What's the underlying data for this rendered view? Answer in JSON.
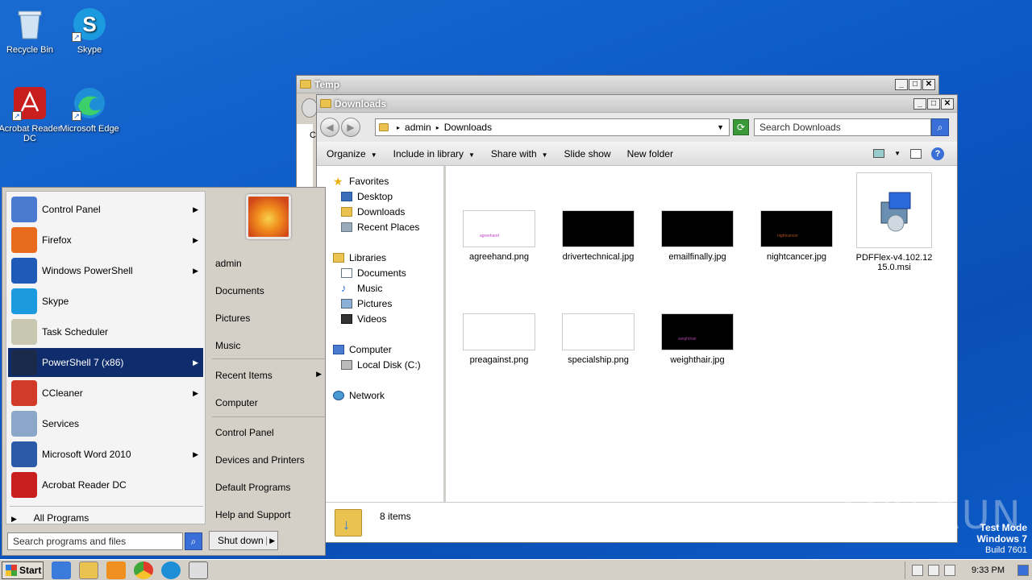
{
  "desktop": {
    "icons": [
      {
        "label": "Recycle Bin"
      },
      {
        "label": "Skype"
      },
      {
        "label": "Acrobat Reader DC"
      },
      {
        "label": "Microsoft Edge"
      }
    ],
    "watermark": "ANY RUN",
    "test_mode": {
      "line1": "Test Mode",
      "line2": "Windows 7",
      "line3": "Build 7601"
    }
  },
  "temp_window": {
    "title": "Temp",
    "partial_letter": "C"
  },
  "explorer": {
    "title": "Downloads",
    "address": {
      "root": "admin",
      "current": "Downloads"
    },
    "search_placeholder": "Search Downloads",
    "commands": [
      "Organize",
      "Include in library",
      "Share with",
      "Slide show",
      "New folder"
    ],
    "nav": {
      "favorites": "Favorites",
      "fav_items": [
        "Desktop",
        "Downloads",
        "Recent Places"
      ],
      "libraries": "Libraries",
      "lib_items": [
        "Documents",
        "Music",
        "Pictures",
        "Videos"
      ],
      "computer": "Computer",
      "comp_items": [
        "Local Disk (C:)"
      ],
      "network": "Network"
    },
    "files": [
      {
        "name": "agreehand.png",
        "thumb": "light",
        "mark": "agreehand",
        "mark_color": "#c040c0"
      },
      {
        "name": "drivertechnical.jpg",
        "thumb": "dark",
        "mark": "",
        "mark_color": "#888888"
      },
      {
        "name": "emailfinally.jpg",
        "thumb": "dark",
        "mark": "",
        "mark_color": "#888888"
      },
      {
        "name": "nightcancer.jpg",
        "thumb": "dark",
        "mark": "nightcancer",
        "mark_color": "#b05020"
      },
      {
        "name": "PDFFlex-v4.102.12 15.0.msi",
        "thumb": "msi",
        "mark": "",
        "mark_color": ""
      },
      {
        "name": "preagainst.png",
        "thumb": "light",
        "mark": "",
        "mark_color": "#8888cc"
      },
      {
        "name": "specialship.png",
        "thumb": "light",
        "mark": "",
        "mark_color": "#aaaaaa"
      },
      {
        "name": "weighthair.jpg",
        "thumb": "dark",
        "mark": "weighthair",
        "mark_color": "#a040a0"
      }
    ],
    "status": "8 items"
  },
  "start_menu": {
    "programs": [
      {
        "label": "Control Panel",
        "arrow": true,
        "icon_color": "#4a7bd0"
      },
      {
        "label": "Firefox",
        "arrow": true,
        "icon_color": "#e86a1c"
      },
      {
        "label": "Windows PowerShell",
        "arrow": true,
        "icon_color": "#1e5bb8"
      },
      {
        "label": "Skype",
        "arrow": false,
        "icon_color": "#1c9ae0"
      },
      {
        "label": "Task Scheduler",
        "arrow": false,
        "icon_color": "#c8c8b0"
      },
      {
        "label": "PowerShell 7 (x86)",
        "arrow": true,
        "icon_color": "#1a2a4a",
        "selected": true
      },
      {
        "label": "CCleaner",
        "arrow": true,
        "icon_color": "#d23a2a"
      },
      {
        "label": "Services",
        "arrow": false,
        "icon_color": "#8aa6c8"
      },
      {
        "label": "Microsoft Word 2010",
        "arrow": true,
        "icon_color": "#2b5aa8"
      },
      {
        "label": "Acrobat Reader DC",
        "arrow": false,
        "icon_color": "#c81e1e"
      }
    ],
    "all_programs": "All Programs",
    "search_placeholder": "Search programs and files",
    "right": {
      "user": "admin",
      "documents": "Documents",
      "pictures": "Pictures",
      "music": "Music",
      "recent": "Recent Items",
      "computer": "Computer",
      "control_panel": "Control Panel",
      "devices": "Devices and Printers",
      "defaults": "Default Programs",
      "help": "Help and Support"
    },
    "shutdown": "Shut down"
  },
  "taskbar": {
    "start": "Start",
    "clock": "9:33 PM"
  }
}
